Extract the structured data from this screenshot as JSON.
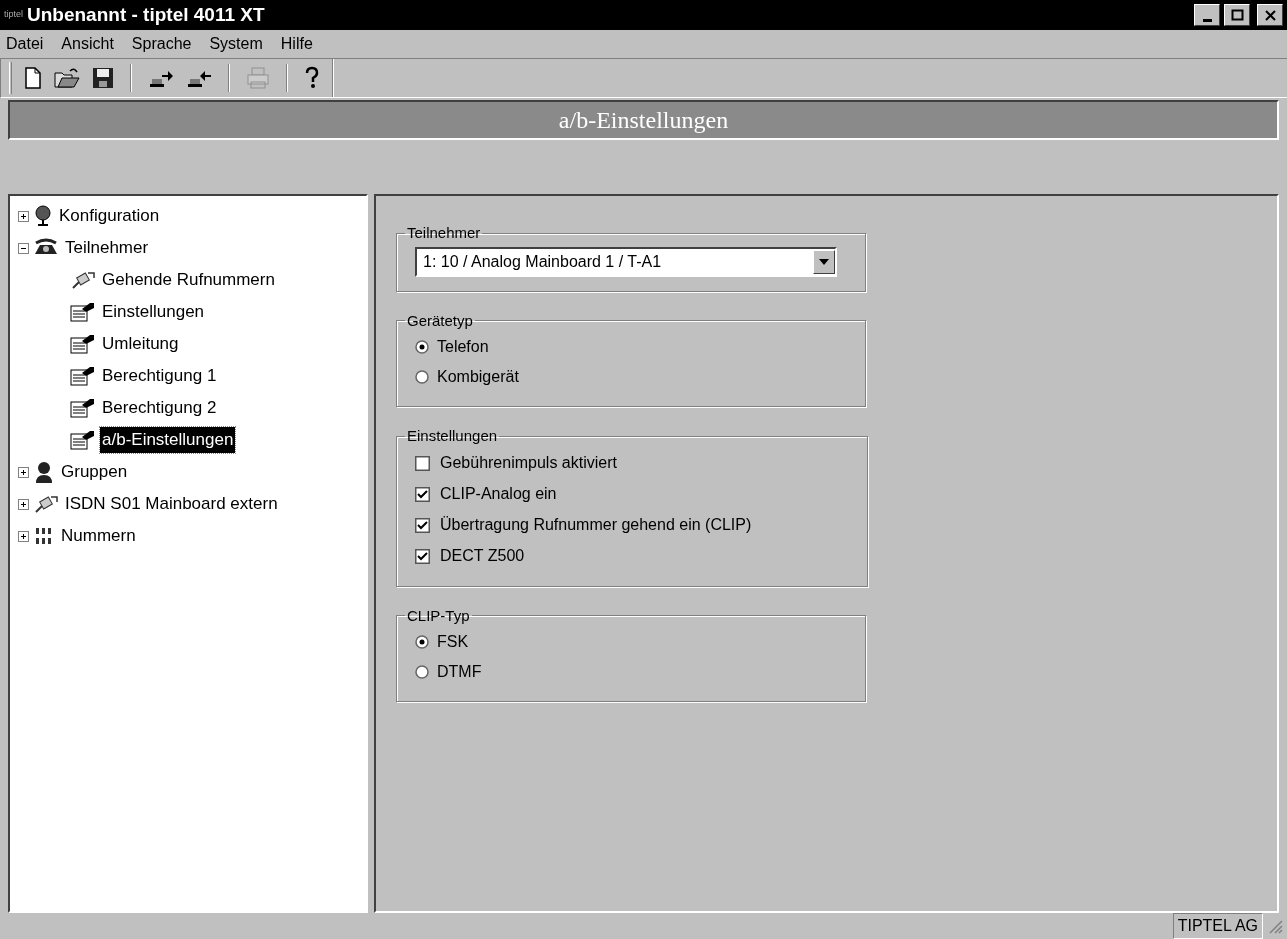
{
  "window": {
    "logo": "tiptel",
    "title": "Unbenannt - tiptel 4011 XT"
  },
  "menu": [
    "Datei",
    "Ansicht",
    "Sprache",
    "System",
    "Hilfe"
  ],
  "toolbar": [
    {
      "kind": "new",
      "disabled": false
    },
    {
      "kind": "open",
      "disabled": false
    },
    {
      "kind": "save",
      "disabled": false
    },
    {
      "kind": "sep"
    },
    {
      "kind": "send",
      "disabled": false
    },
    {
      "kind": "receive",
      "disabled": false
    },
    {
      "kind": "sep"
    },
    {
      "kind": "print",
      "disabled": true
    },
    {
      "kind": "sep"
    },
    {
      "kind": "help",
      "disabled": false
    }
  ],
  "header": "a/b-Einstellungen",
  "tree": [
    {
      "label": "Konfiguration",
      "kind": "globe",
      "expanded": false,
      "selected": false
    },
    {
      "label": "Teilnehmer",
      "kind": "phone",
      "expanded": true,
      "selected": false,
      "children": [
        {
          "label": "Gehende Rufnummern",
          "kind": "plug",
          "selected": false
        },
        {
          "label": "Einstellungen",
          "kind": "sheet",
          "selected": false
        },
        {
          "label": "Umleitung",
          "kind": "sheet",
          "selected": false
        },
        {
          "label": "Berechtigung 1",
          "kind": "sheet",
          "selected": false
        },
        {
          "label": "Berechtigung 2",
          "kind": "sheet",
          "selected": false
        },
        {
          "label": "a/b-Einstellungen",
          "kind": "sheet",
          "selected": true
        }
      ]
    },
    {
      "label": "Gruppen",
      "kind": "person",
      "expanded": false,
      "selected": false
    },
    {
      "label": "ISDN S01 Mainboard extern",
      "kind": "plug",
      "expanded": false,
      "selected": false
    },
    {
      "label": "Nummern",
      "kind": "numbers",
      "expanded": false,
      "selected": false
    }
  ],
  "groups": [
    {
      "title": "Teilnehmer",
      "kind": "select",
      "value": "1: 10 / Analog Mainboard 1 / T-A1"
    },
    {
      "title": "Gerätetyp",
      "kind": "radio",
      "options": [
        {
          "label": "Telefon",
          "selected": true
        },
        {
          "label": "Kombigerät",
          "selected": false
        }
      ]
    },
    {
      "title": "Einstellungen",
      "kind": "checkbox",
      "options": [
        {
          "label": "Gebührenimpuls aktiviert",
          "checked": false
        },
        {
          "label": "CLIP-Analog ein",
          "checked": true
        },
        {
          "label": "Übertragung Rufnummer gehend ein (CLIP)",
          "checked": true
        },
        {
          "label": "DECT Z500",
          "checked": true
        }
      ]
    },
    {
      "title": "CLIP-Typ",
      "kind": "radio",
      "options": [
        {
          "label": "FSK",
          "selected": true
        },
        {
          "label": "DTMF",
          "selected": false
        }
      ]
    }
  ],
  "status_bar": {
    "company": "TIPTEL AG"
  }
}
